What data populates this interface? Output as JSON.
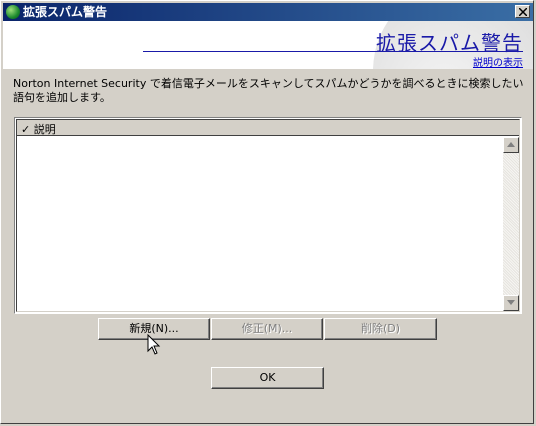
{
  "window": {
    "title": "拡張スパム警告",
    "close_icon": "close-icon"
  },
  "header": {
    "title": "拡張スパム警告",
    "help_link": "説明の表示"
  },
  "description": "Norton Internet Security で着信電子メールをスキャンしてスパムかどうかを調べるときに検索したい語句を追加します。",
  "list": {
    "columns": [
      {
        "label": "説明",
        "checked": true
      }
    ],
    "rows": []
  },
  "buttons": {
    "new": "新規(N)...",
    "edit": "修正(M)...",
    "delete": "削除(D)",
    "ok": "OK"
  }
}
